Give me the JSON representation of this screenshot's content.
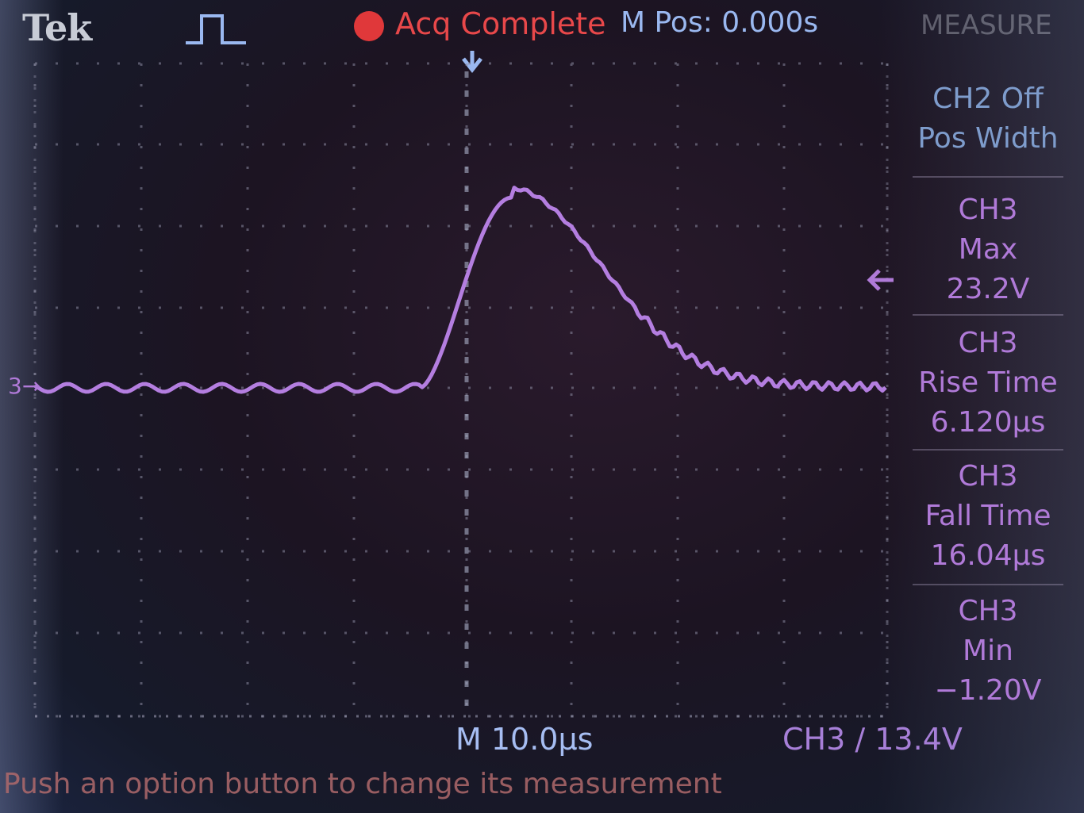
{
  "header": {
    "brand": "Tek",
    "acq_status": "Acq Complete",
    "m_pos": "M Pos: 0.000s",
    "menu_title": "MEASURE"
  },
  "measurements": {
    "slot1": {
      "line1": "CH2 Off",
      "line2": "Pos Width"
    },
    "slot2": {
      "line1": "CH3",
      "line2": "Max",
      "line3": "23.2V"
    },
    "slot3": {
      "line1": "CH3",
      "line2": "Rise Time",
      "line3": "6.120µs"
    },
    "slot4": {
      "line1": "CH3",
      "line2": "Fall Time",
      "line3": "16.04µs"
    },
    "slot5": {
      "line1": "CH3",
      "line2": "Min",
      "line3": "−1.20V"
    }
  },
  "footer": {
    "timebase": "M 10.0µs",
    "trigger": "CH3 ∕ 13.4V",
    "status_msg": "Push an option button to change its measurement"
  },
  "channel_marker": "3",
  "colors": {
    "trace": "#b07ad8",
    "acq": "#e0383a",
    "cursor": "#9ab8f0",
    "grid": "#8a8aa0"
  }
}
